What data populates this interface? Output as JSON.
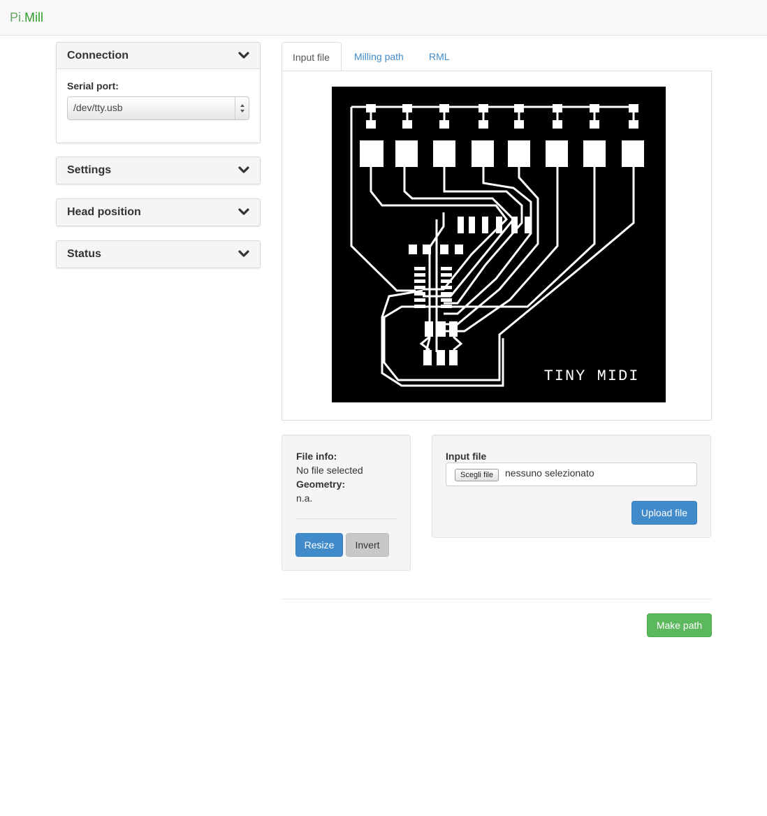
{
  "navbar": {
    "brand_prefix": "Pi.",
    "brand_suffix": "Mill"
  },
  "sidebar": {
    "connection": {
      "title": "Connection",
      "serial_label": "Serial port:",
      "serial_value": "/dev/tty.usb"
    },
    "settings": {
      "title": "Settings"
    },
    "head_position": {
      "title": "Head position"
    },
    "status": {
      "title": "Status"
    }
  },
  "tabs": [
    {
      "label": "Input file",
      "active": true
    },
    {
      "label": "Milling path",
      "active": false
    },
    {
      "label": "RML",
      "active": false
    }
  ],
  "preview": {
    "pcb_text": "TINY MIDI"
  },
  "file_info": {
    "file_label": "File info:",
    "file_value": "No file selected",
    "geometry_label": "Geometry:",
    "geometry_value": "n.a.",
    "resize_label": "Resize",
    "invert_label": "Invert"
  },
  "upload": {
    "label": "Input file",
    "choose_label": "Scegli file",
    "status": "nessuno selezionato",
    "upload_label": "Upload file"
  },
  "footer": {
    "make_path_label": "Make path"
  },
  "colors": {
    "primary": "#428bca",
    "success": "#5cb85c",
    "brand_green": "#2e9f2e"
  }
}
